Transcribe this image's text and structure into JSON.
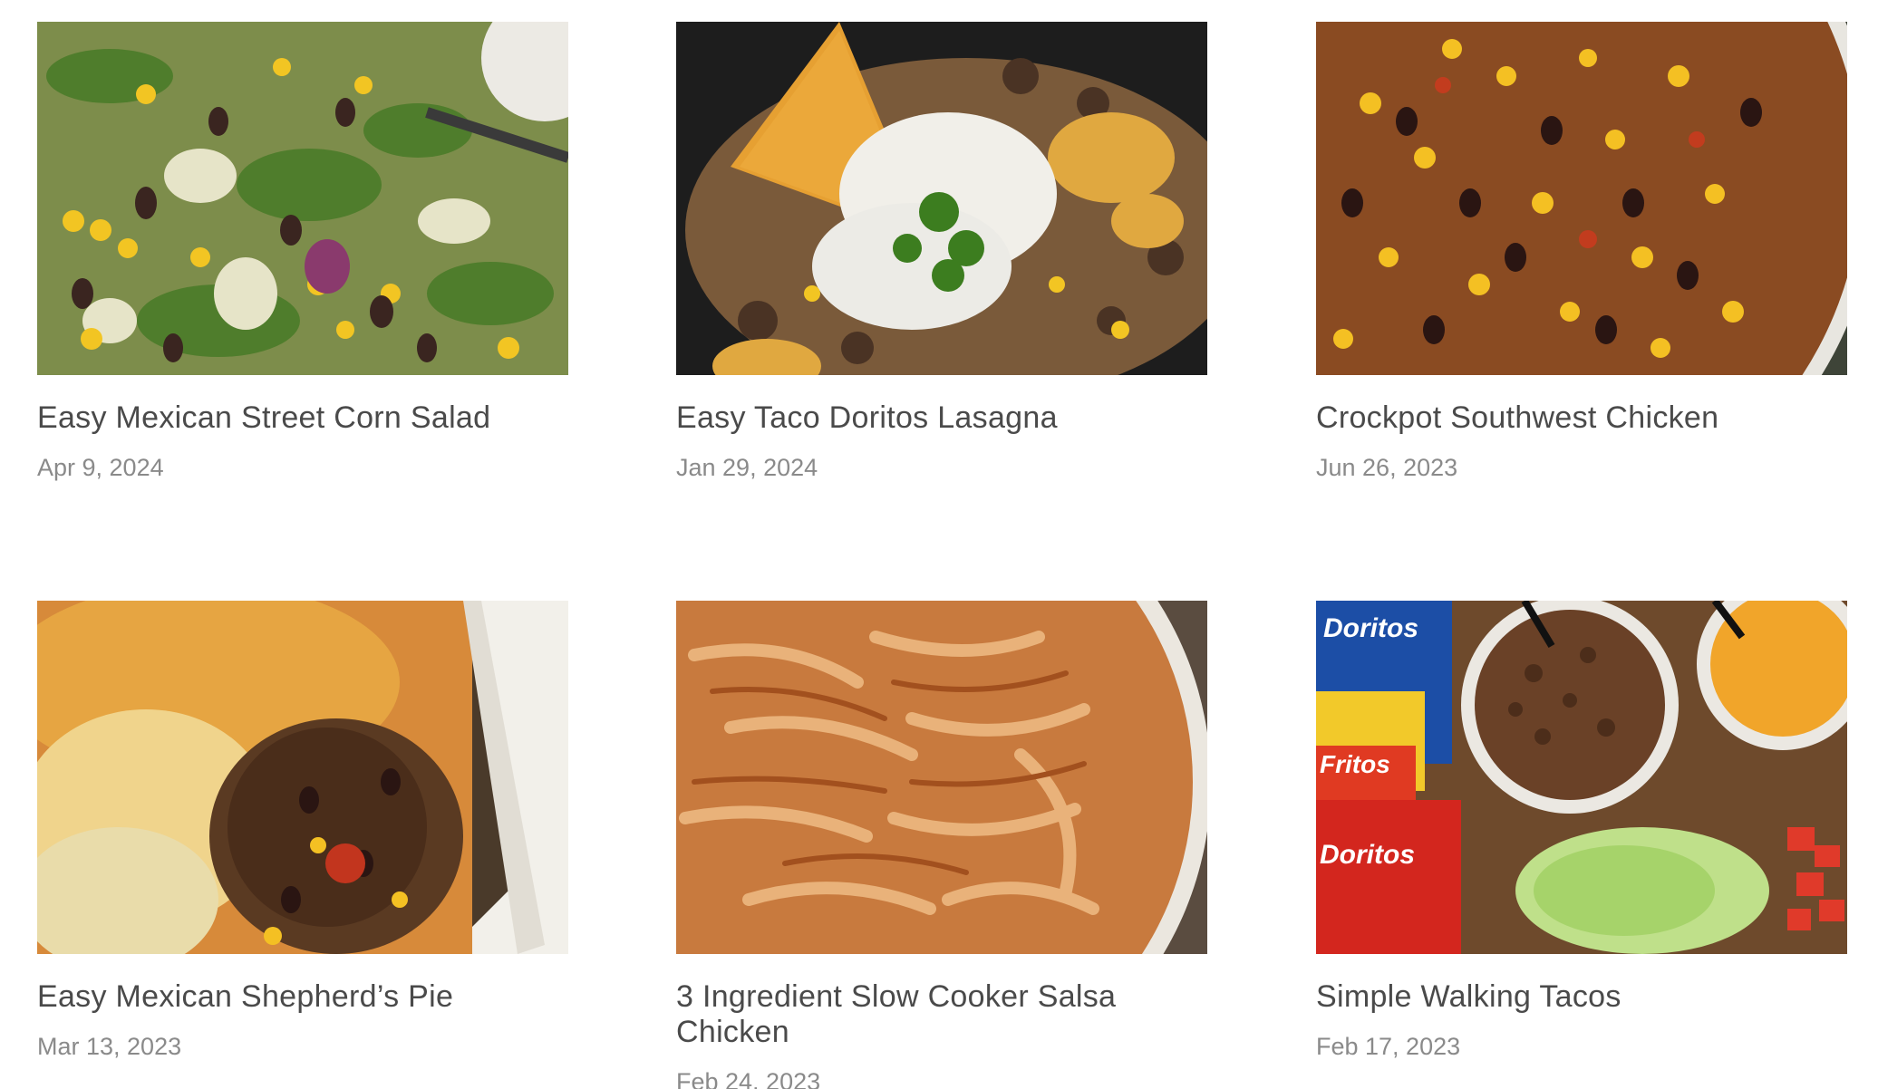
{
  "posts": [
    {
      "title": "Easy Mexican Street Corn Salad",
      "date": "Apr 9, 2024",
      "image": "street-corn-salad-photo"
    },
    {
      "title": "Easy Taco Doritos Lasagna",
      "date": "Jan 29, 2024",
      "image": "taco-doritos-lasagna-photo"
    },
    {
      "title": "Crockpot Southwest Chicken",
      "date": "Jun 26, 2023",
      "image": "southwest-chicken-photo"
    },
    {
      "title": "Easy Mexican Shepherd’s Pie",
      "date": "Mar 13, 2023",
      "image": "shepherds-pie-photo"
    },
    {
      "title": "3 Ingredient Slow Cooker Salsa Chicken",
      "date": "Feb 24, 2023",
      "image": "salsa-chicken-photo"
    },
    {
      "title": "Simple Walking Tacos",
      "date": "Feb 17, 2023",
      "image": "walking-tacos-photo"
    }
  ],
  "image_text": {
    "doritos_label": "Doritos",
    "fritos_label": "Fritos"
  },
  "colors": {
    "title": "#4a4a4a",
    "date": "#8a8a8a",
    "background": "#ffffff"
  }
}
